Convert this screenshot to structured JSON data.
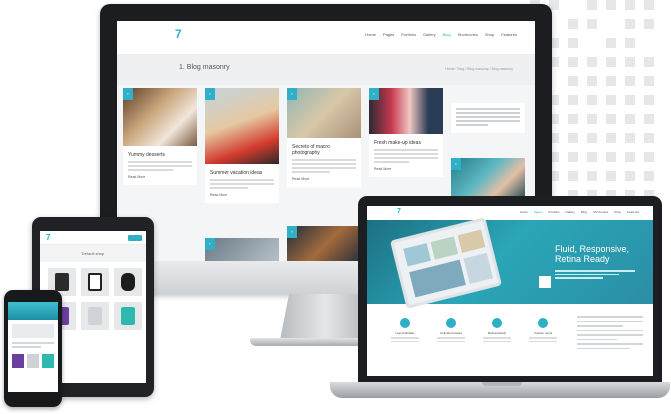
{
  "imac": {
    "nav": [
      "Home",
      "Pages",
      "Portfolio",
      "Gallery",
      "Blog",
      "Shortcodes",
      "Shop",
      "Features"
    ],
    "nav_active": "Blog",
    "page_title": "1. Blog masonry",
    "breadcrumbs": "Home / Blog / Blog masonry / Blog masonry",
    "posts": [
      {
        "title": "Yummy desserts",
        "readmore": "Read More"
      },
      {
        "title": "Summer vacation ideas",
        "readmore": "Read More"
      },
      {
        "title": "Secrets of macro photography",
        "readmore": "Read More"
      },
      {
        "title": "Fresh make-up ideas",
        "readmore": "Read More"
      }
    ]
  },
  "tablet": {
    "title": "Default shop"
  },
  "laptop": {
    "nav": [
      "Home",
      "Pages",
      "Portfolio",
      "Gallery",
      "Blog",
      "Shortcodes",
      "Shop",
      "Features"
    ],
    "nav_active": "Pages",
    "hero_title": "Fluid, Responsive, Retina Ready",
    "features": [
      "Layout Builder",
      "Unlimited Colors",
      "Retina Ready",
      "Custom Icons"
    ]
  },
  "colors": {
    "accent": "#2fb0c6",
    "hero": "#2aa6b7",
    "bezel": "#1b1d20"
  }
}
